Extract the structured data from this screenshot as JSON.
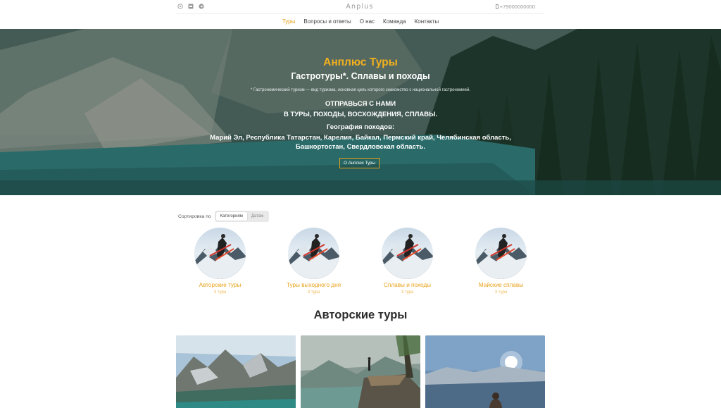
{
  "topbar": {
    "social_icons": [
      "whatsapp-icon",
      "vk-icon",
      "telegram-icon"
    ],
    "logo": "Anplus",
    "phone": "+79000000000"
  },
  "nav": {
    "items": [
      {
        "label": "Туры",
        "active": true
      },
      {
        "label": "Вопросы и ответы",
        "active": false
      },
      {
        "label": "О нас",
        "active": false
      },
      {
        "label": "Команда",
        "active": false
      },
      {
        "label": "Контакты",
        "active": false
      }
    ]
  },
  "hero": {
    "title": "Анплюс Туры",
    "subtitle": "Гастротуры*. Сплавы и походы",
    "note": "* Гастрономический туризм — вид туризма, основная цель которого знакомство с национальной гастрономией.",
    "go_line1": "ОТПРАВЬСЯ С НАМИ",
    "go_line2": "В ТУРЫ, ПОХОДЫ, ВОСХОЖДЕНИЯ, СПЛАВЫ.",
    "geo_title": "География походов:",
    "geo_text": "Марий Эл, Республика Татарстан, Карелия, Байкал, Пермский край, Челябинская область, Башкортостан, Свердловская область.",
    "button": "О Анплюс Туры"
  },
  "sort": {
    "label": "Сортировка по",
    "options": [
      {
        "label": "Категориям",
        "selected": true
      },
      {
        "label": "Датам",
        "selected": false
      }
    ]
  },
  "categories": [
    {
      "name": "Авторские туры",
      "count": "3 тура"
    },
    {
      "name": "Туры выходного дня",
      "count": "3 тура"
    },
    {
      "name": "Сплавы и походы",
      "count": "3 тура"
    },
    {
      "name": "Майские сплавы",
      "count": "3 тура"
    }
  ],
  "section_title": "Авторские туры",
  "colors": {
    "accent": "#e9a11a",
    "text": "#333333"
  }
}
